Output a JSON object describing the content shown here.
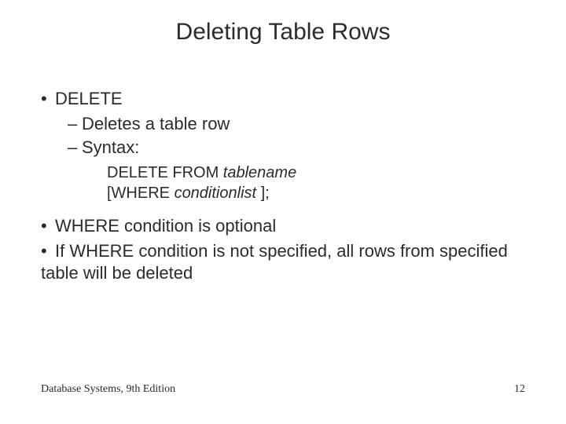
{
  "title": "Deleting Table Rows",
  "bullets": {
    "b1a": "DELETE",
    "b2a": "Deletes a table row",
    "b2b": "Syntax:",
    "syntax1_plain": "DELETE FROM ",
    "syntax1_italic": "tablename",
    "syntax2_plain1": "[WHERE ",
    "syntax2_italic": "conditionlist ",
    "syntax2_plain2": "];",
    "b1b": "WHERE condition is optional",
    "b1c": "If WHERE condition is not specified, all rows from specified table will be deleted"
  },
  "footer": {
    "left": "Database Systems, 9th Edition",
    "right": "12"
  }
}
